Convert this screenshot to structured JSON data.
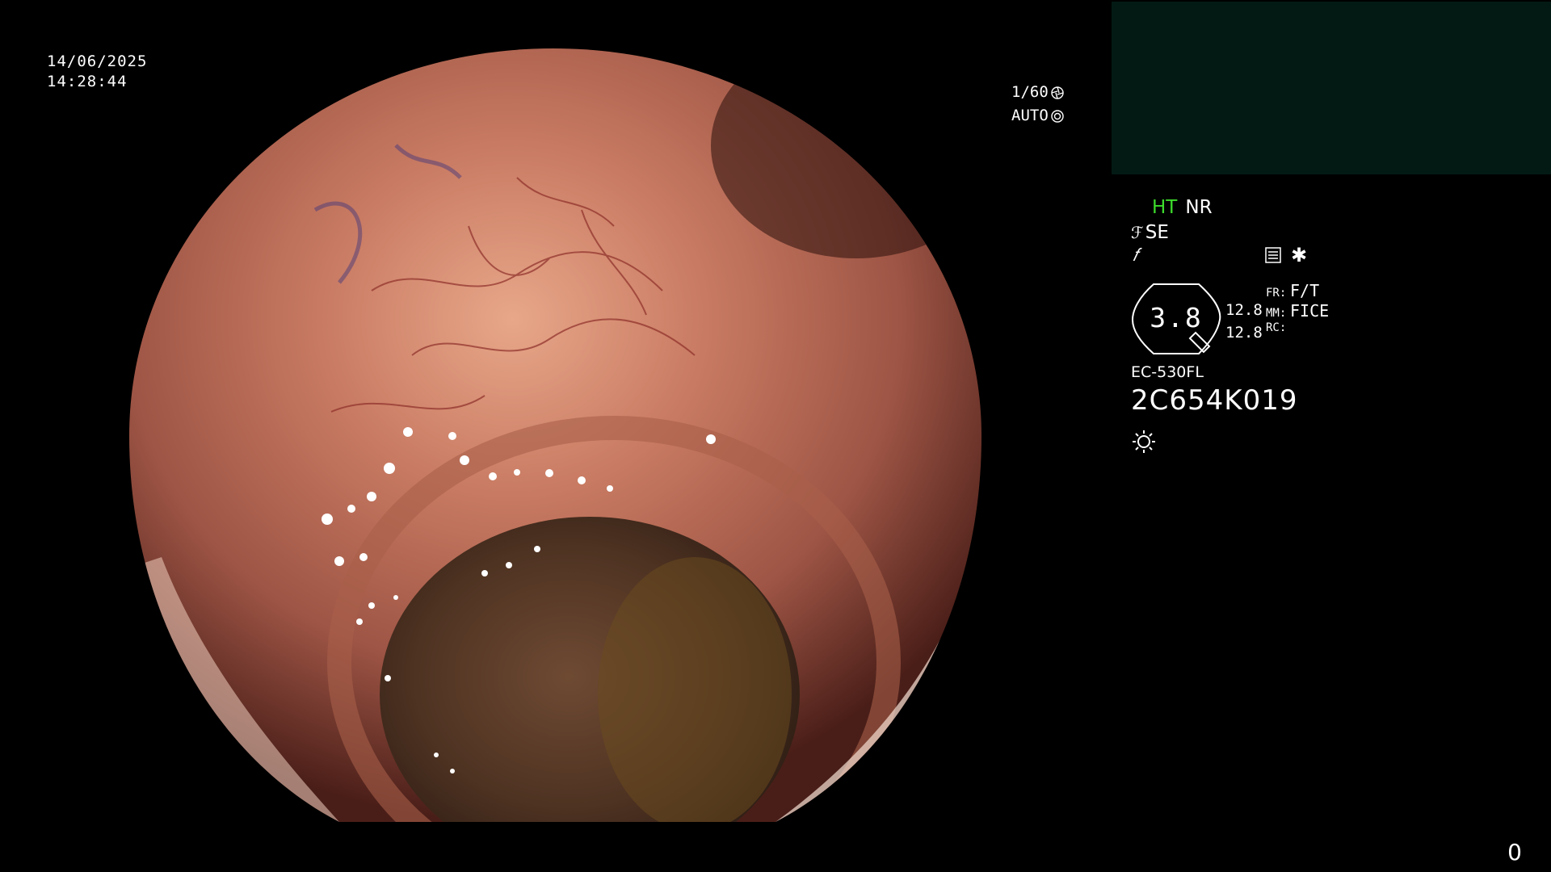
{
  "datetime": {
    "date": "14/06/2025",
    "time": "14:28:44"
  },
  "shutter": {
    "speed": "1/60",
    "mode": "AUTO"
  },
  "modes": {
    "ht": "HT",
    "nr": "NR",
    "se": "SE"
  },
  "zoom": {
    "value": "3.8",
    "num1": "12.8",
    "num2": "12.8"
  },
  "settings": {
    "fr_key": "FR:",
    "fr_val": "F/T",
    "mm_key": "MM:",
    "mm_val": "FICE",
    "rc_key": "RC:",
    "rc_val": ""
  },
  "scope": {
    "model": "EC-530FL",
    "serial": "2C654K019"
  },
  "corner_counter": "0",
  "colors": {
    "ht_green": "#3ddc2c",
    "thumbnail_panel": "#031a14",
    "mucosa": "#b5604a"
  },
  "icons": [
    "aperture-icon",
    "iris-icon",
    "se-icon",
    "f-icon",
    "menu-icon",
    "star-icon",
    "light-icon"
  ]
}
